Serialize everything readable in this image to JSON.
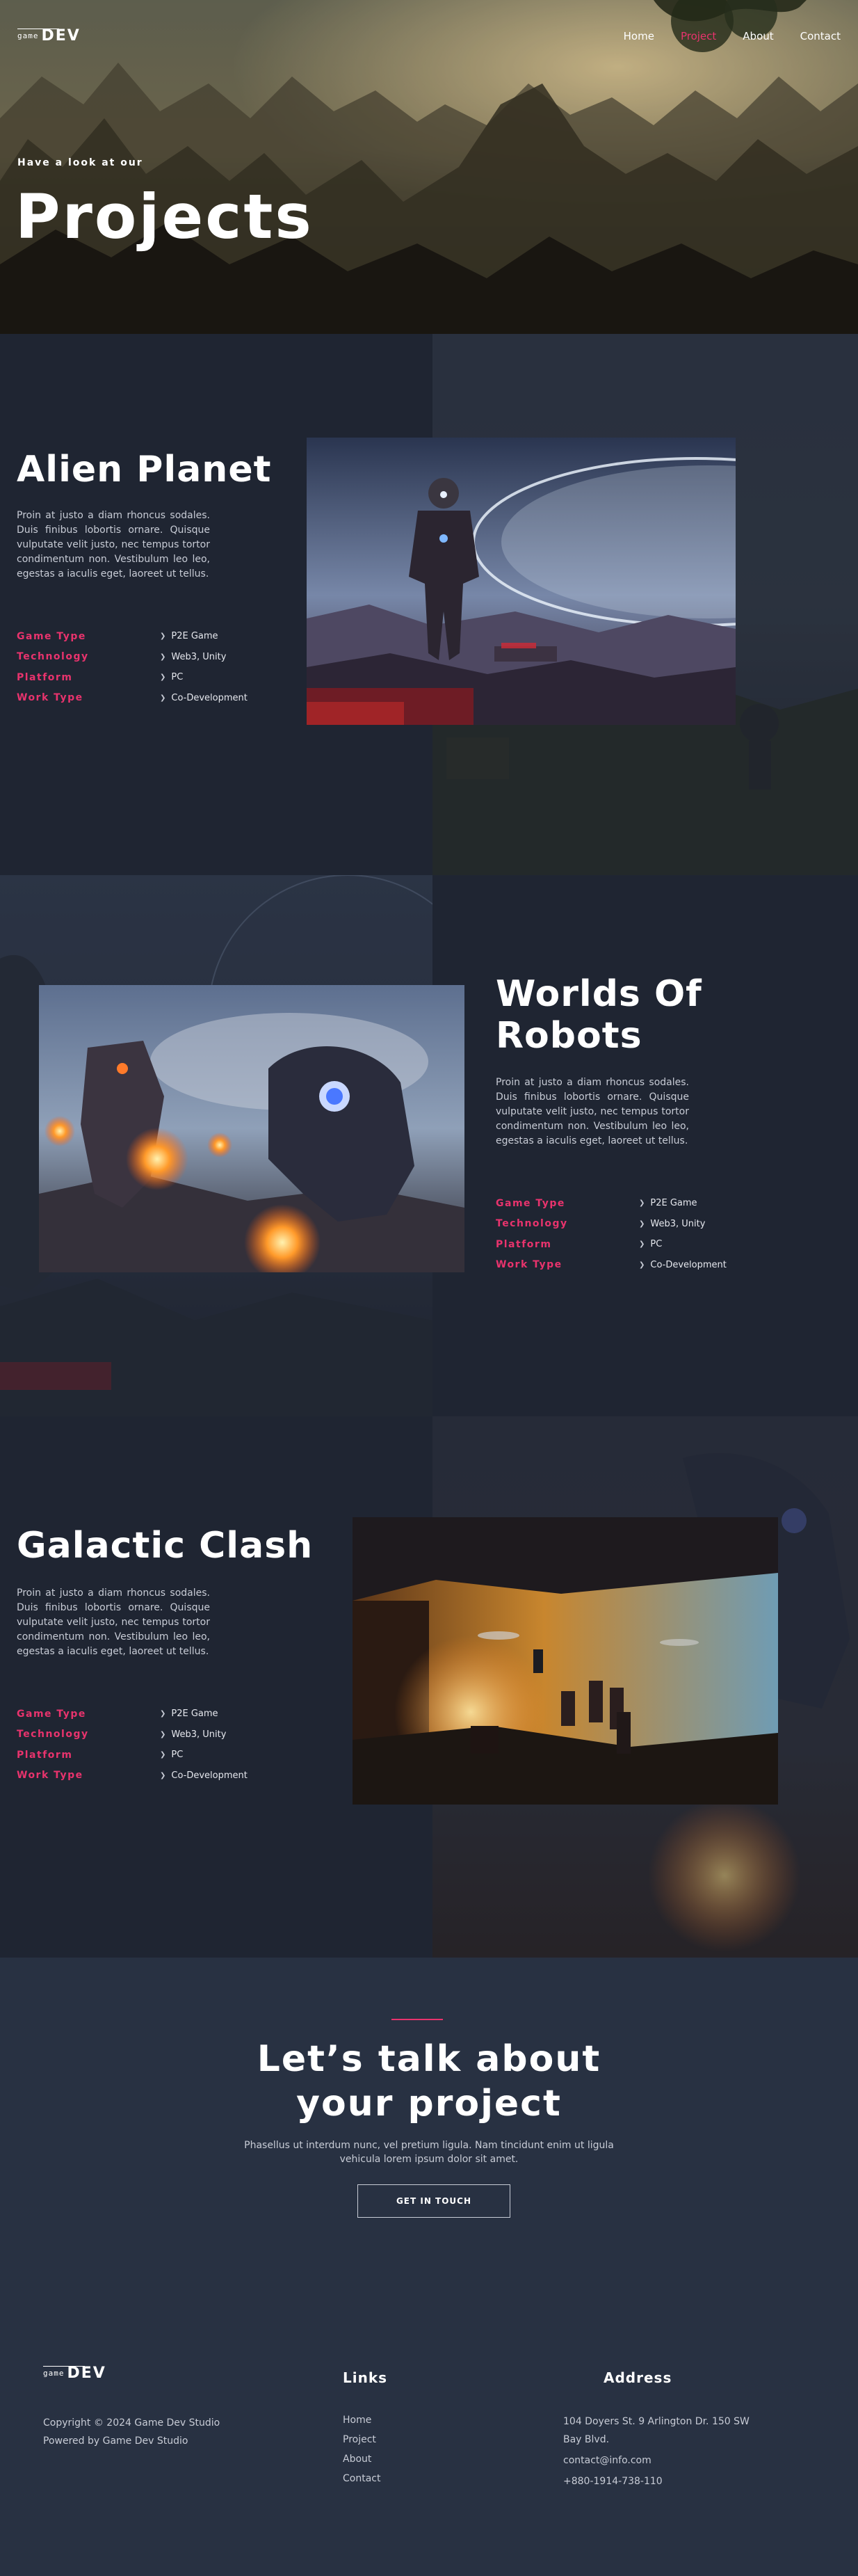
{
  "nav": {
    "logo_small": "game",
    "logo_big": "DEV",
    "links": [
      "Home",
      "Project",
      "About",
      "Contact"
    ],
    "active_index": 1
  },
  "hero": {
    "subtitle": "Have a look at our",
    "title": "Projects"
  },
  "spec_labels": {
    "game_type": "Game Type",
    "technology": "Technology",
    "platform": "Platform",
    "work_type": "Work Type"
  },
  "projects": [
    {
      "title": "Alien Planet",
      "description": "Proin at justo a diam rhoncus sodales. Duis finibus lobortis ornare. Quisque vulputate velit justo, nec tempus tortor condimentum non. Vestibulum leo leo, egestas a iaculis eget, laoreet ut tellus.",
      "game_type": "P2E Game",
      "technology": "Web3, Unity",
      "platform": "PC",
      "work_type": "Co-Development"
    },
    {
      "title_line1": "Worlds Of",
      "title_line2": "Robots",
      "description": "Proin at justo a diam rhoncus sodales. Duis finibus lobortis ornare. Quisque vulputate velit justo, nec tempus tortor condimentum non. Vestibulum leo leo, egestas a iaculis eget, laoreet ut tellus.",
      "game_type": "P2E Game",
      "technology": "Web3, Unity",
      "platform": "PC",
      "work_type": "Co-Development"
    },
    {
      "title": "Galactic Clash",
      "description": "Proin at justo a diam rhoncus sodales. Duis finibus lobortis ornare. Quisque vulputate velit justo, nec tempus tortor condimentum non. Vestibulum leo leo, egestas a iaculis eget, laoreet ut tellus.",
      "game_type": "P2E Game",
      "technology": "Web3, Unity",
      "platform": "PC",
      "work_type": "Co-Development"
    }
  ],
  "cta": {
    "title_line1": "Let’s talk about",
    "title_line2": "your project",
    "text": "Phasellus ut interdum nunc, vel pretium ligula. Nam tincidunt enim ut ligula vehicula lorem ipsum dolor sit amet.",
    "button": "GET IN TOUCH"
  },
  "footer": {
    "logo_small": "game",
    "logo_big": "DEV",
    "copyright": "Copyright © 2024 Game Dev Studio",
    "powered": "Powered by Game Dev Studio",
    "links_title": "Links",
    "links": [
      "Home",
      "Project",
      "About",
      "Contact"
    ],
    "address_title": "Address",
    "address_line1": "104 Doyers St. 9 Arlington Dr. 150 SW",
    "address_line2": "Bay Blvd.",
    "email": "contact@info.com",
    "phone": "+880-1914-738-110"
  },
  "colors": {
    "accent": "#e8336d",
    "background": "#1f2532",
    "cta_background": "#283142"
  }
}
